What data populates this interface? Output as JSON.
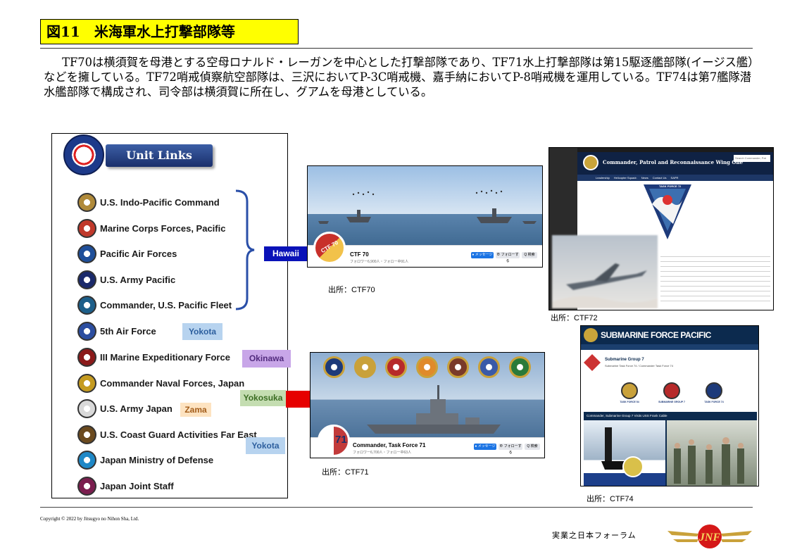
{
  "title": "図11　米海軍水上打撃部隊等",
  "intro": "TF70は横須賀を母港とする空母ロナルド・レーガンを中心とした打撃部隊であり、TF71水上打撃部隊は第15駆逐艦部隊(イージス艦）などを擁している。TF72哨戒偵察航空部隊は、三沢においてP-3C哨戒機、嘉手納においてP-8哨戒機を運用している。TF74は第7艦隊潜水艦部隊で構成され、司令部は横須賀に所在し、グアムを母港としている。",
  "unit_links": {
    "header": "Unit Links",
    "items": [
      {
        "label": "U.S. Indo-Pacific Command",
        "seal_icon": "indopacom-seal-icon",
        "color": "#b08a3a"
      },
      {
        "label": "Marine Corps Forces, Pacific",
        "seal_icon": "marforpac-seal-icon",
        "color": "#c0392b"
      },
      {
        "label": "Pacific Air Forces",
        "seal_icon": "pacaf-shield-icon",
        "color": "#1f4f9a"
      },
      {
        "label": "U.S. Army Pacific",
        "seal_icon": "usarpac-seal-icon",
        "color": "#1b2a6b"
      },
      {
        "label": "Commander, U.S. Pacific Fleet",
        "seal_icon": "pacflt-seal-icon",
        "color": "#1d5f8a"
      },
      {
        "label": "5th Air Force",
        "seal_icon": "5af-shield-icon",
        "color": "#2c4ea0"
      },
      {
        "label": "III Marine Expeditionary Force",
        "seal_icon": "iii-mef-shield-icon",
        "color": "#8b1a1a"
      },
      {
        "label": "Commander Naval Forces, Japan",
        "seal_icon": "cnfj-seal-icon",
        "color": "#c59b20"
      },
      {
        "label": "U.S. Army Japan",
        "seal_icon": "usarj-seal-icon",
        "color": "#d9d9d9"
      },
      {
        "label": "U.S. Coast Guard Activities Far East",
        "seal_icon": "uscg-seal-icon",
        "color": "#6b4a1f"
      },
      {
        "label": "Japan Ministry of Defense",
        "seal_icon": "jmod-logo-icon",
        "color": "#1e88c7"
      },
      {
        "label": "Japan Joint Staff",
        "seal_icon": "jjs-seal-icon",
        "color": "#7b1e4f"
      }
    ]
  },
  "tags": {
    "hawaii": "Hawaii",
    "yokota_1": "Yokota",
    "okinawa": "Okinawa",
    "yokosuka": "Yokosuka",
    "zama": "Zama",
    "yokota_2": "Yokota"
  },
  "screens": {
    "ctf70": {
      "page_name": "CTF 70",
      "sub": "フォロワー6,900人・フォロー中91人",
      "message": "● メッセージ",
      "follow": "⊕ フォローする",
      "search": "Q 検索",
      "avatar_text": "CTF 70",
      "caption": "出所：CTF70"
    },
    "ctf71": {
      "page_name": "Commander, Task Force 71",
      "sub": "フォロワー6,700人・フォロー中63人",
      "message": "● メッセージ",
      "follow": "⊕ フォローする",
      "search": "Q 検索",
      "avatar_text": "71",
      "caption": "出所：CTF71"
    },
    "ctf72": {
      "site_title": "Commander, Patrol and Reconnaissance Wing One",
      "search_placeholder": "Search Commander, Pat",
      "nav": [
        "Leadership",
        "Helicopter Squadr.",
        "News",
        "Contact Us",
        "SAPR"
      ],
      "emblem_text": "TASK FORCE 72",
      "caption": "出所：CTF72"
    },
    "ctf74": {
      "site_title": "SUBMARINE FORCE PACIFIC",
      "page_name": "Submarine Group 7",
      "page_sub": "Submarine Task Force 74 / Commander Task Force 74",
      "emblems": [
        "TASK FORCE 54",
        "SUBMARINE GROUP 7",
        "TASK FORCE 74"
      ],
      "video_title": "Commander, Submarine Group 7 Visits USS Frank Cable",
      "caption": "出所：CTF74"
    }
  },
  "footer": {
    "copyright": "Copyright © 2022 by Jitsugyo no Nihon Sha, Ltd.",
    "forum": "実業之日本フォーラム",
    "logo_text": "JNF"
  },
  "colors": {
    "title_bg": "#ffff00",
    "hawaii_tag": "#0a12b8",
    "brace": "#2a4fa8",
    "arrow": "#e60000"
  }
}
